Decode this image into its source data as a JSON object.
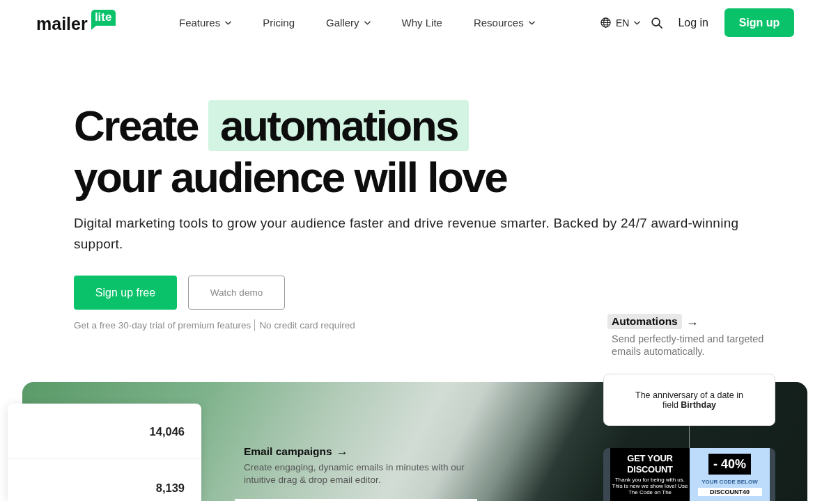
{
  "header": {
    "logo": {
      "wordmark": "mailer",
      "badge": "lite"
    },
    "nav": [
      {
        "label": "Features",
        "has_menu": true
      },
      {
        "label": "Pricing",
        "has_menu": false
      },
      {
        "label": "Gallery",
        "has_menu": true
      },
      {
        "label": "Why Lite",
        "has_menu": false
      },
      {
        "label": "Resources",
        "has_menu": true
      }
    ],
    "language": "EN",
    "login": "Log in",
    "signup": "Sign up"
  },
  "hero": {
    "title_start": "Create",
    "title_highlight": "automations",
    "title_end": "your audience will love",
    "subtitle": "Digital marketing tools to grow your audience faster and drive revenue smarter. Backed by 24/7 award-winning support.",
    "buttons": [
      {
        "label": "Sign up free",
        "kind": "primary"
      },
      {
        "label": "Watch demo",
        "kind": "secondary"
      }
    ],
    "notes": [
      "Get a free 30-day trial of premium features",
      "No credit card required"
    ],
    "feature": {
      "title": "Automations",
      "arrow": "→",
      "description": "Send perfectly-timed and targeted emails automatically.",
      "selected": true
    }
  },
  "showcase": {
    "feature": {
      "title": "Email campaigns",
      "arrow": "→",
      "description": "Create engaging, dynamic emails in minutes with our intuitive drag & drop email editor.",
      "selected": false
    },
    "stats": [
      "14,046",
      "8,139"
    ],
    "trigger": "The anniversary of a date in field **Birthday**",
    "email": {
      "headline": "GET YOUR DISCOUNT",
      "body": "Thank you for being with us. This is new we show love! Use The Code on The",
      "discount": "- 40%",
      "code_label": "YOUR CODE BELOW",
      "code": "DISCOUNT40"
    }
  }
}
